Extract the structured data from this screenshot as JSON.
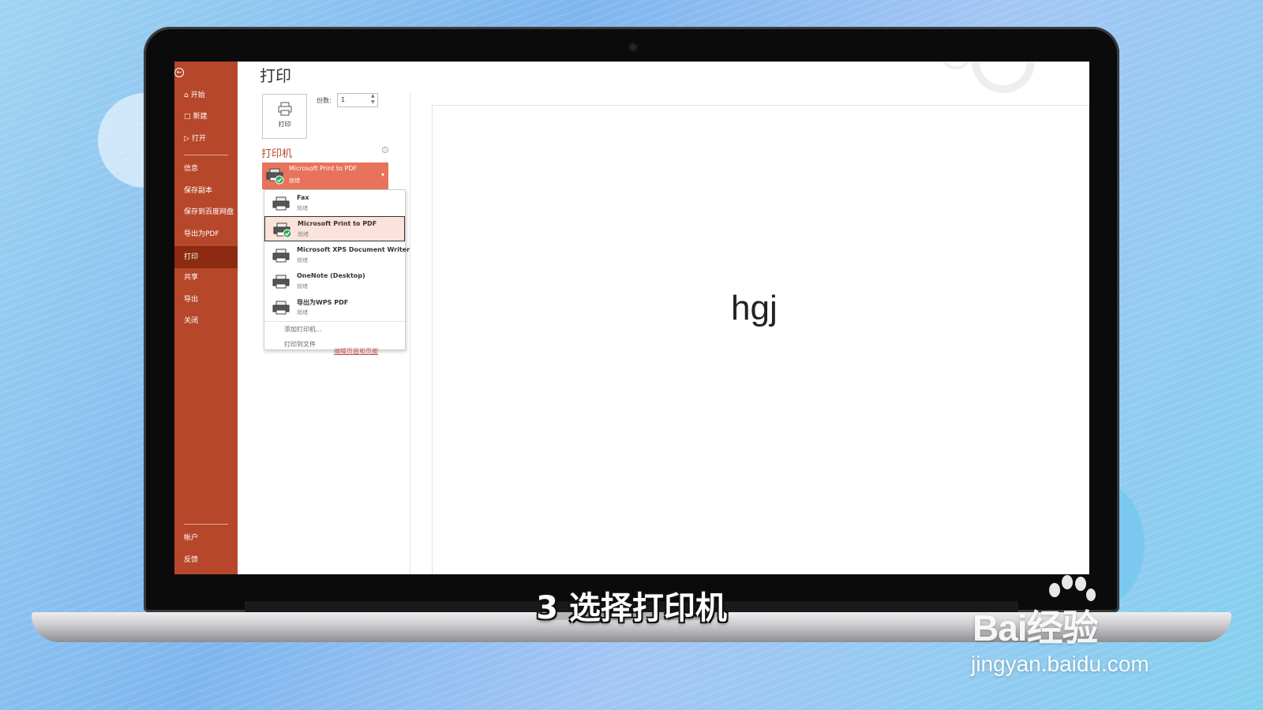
{
  "window": {
    "title": "打印"
  },
  "sidebar": {
    "top_items": [
      {
        "icon": "home-icon",
        "label": "开始"
      },
      {
        "icon": "new-doc-icon",
        "label": "新建"
      },
      {
        "icon": "open-folder-icon",
        "label": "打开"
      }
    ],
    "items": [
      {
        "label": "信息"
      },
      {
        "label": "保存副本"
      },
      {
        "label": "保存到百度网盘"
      },
      {
        "label": "导出为PDF"
      },
      {
        "label": "打印",
        "active": true
      },
      {
        "label": "共享"
      },
      {
        "label": "导出"
      },
      {
        "label": "关闭"
      }
    ],
    "bottom_items": [
      {
        "label": "帐户"
      },
      {
        "label": "反馈"
      }
    ]
  },
  "print_panel": {
    "print_button_label": "打印",
    "copies_label": "份数:",
    "copies_value": "1",
    "printer_section_title": "打印机",
    "selected_printer": {
      "name": "Microsoft Print to PDF",
      "status": "就绪"
    },
    "dropdown": {
      "printers": [
        {
          "name": "Fax",
          "status": "就绪"
        },
        {
          "name": "Microsoft Print to PDF",
          "status": "就绪",
          "selected": true
        },
        {
          "name": "Microsoft XPS Document Writer",
          "status": "就绪"
        },
        {
          "name": "OneNote (Desktop)",
          "status": "就绪"
        },
        {
          "name": "导出为WPS PDF",
          "status": "就绪"
        }
      ],
      "add_printer": "添加打印机...",
      "print_to_file": "打印到文件"
    },
    "printer_properties_link": "编辑页眉和页脚"
  },
  "preview": {
    "text": "hgj"
  },
  "overlay": {
    "caption": "3 选择打印机",
    "watermark_brand": "Bai经验",
    "watermark_url": "jingyan.baidu.com"
  },
  "colors": {
    "sidebar_bg": "#b7472a",
    "sidebar_active": "#8c2a12",
    "accent": "#b7472a",
    "selected_printer_bg": "#e8735c",
    "dropdown_selected_bg": "#fbe2da"
  }
}
